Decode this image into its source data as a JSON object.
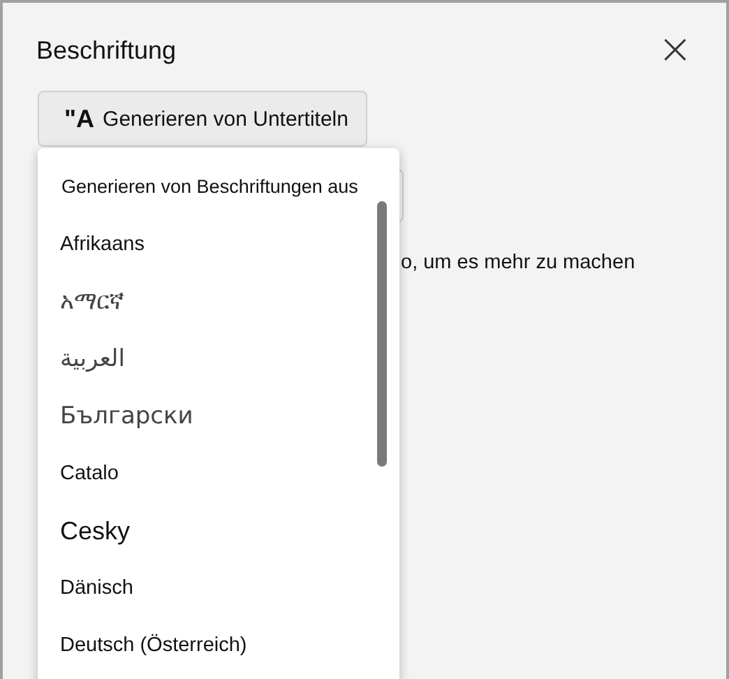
{
  "window": {
    "title": "Beschriftung",
    "close": "×"
  },
  "button": {
    "icon": "\"A",
    "label": "Generieren von Untertiteln"
  },
  "background_text": "o, um es mehr zu machen",
  "dropdown": {
    "header": "Generieren von Beschriftungen aus",
    "items": [
      {
        "label": "Afrikaans",
        "kind": "plain"
      },
      {
        "label": "አማርኛ",
        "kind": "native"
      },
      {
        "label": "العربية",
        "kind": "native"
      },
      {
        "label": "Български",
        "kind": "native"
      },
      {
        "label": "Catalo",
        "kind": "plain"
      },
      {
        "label": "Cesky",
        "kind": "large"
      },
      {
        "label": "Dänisch",
        "kind": "plain"
      },
      {
        "label": "Deutsch (Österreich)",
        "kind": "plain"
      }
    ]
  }
}
